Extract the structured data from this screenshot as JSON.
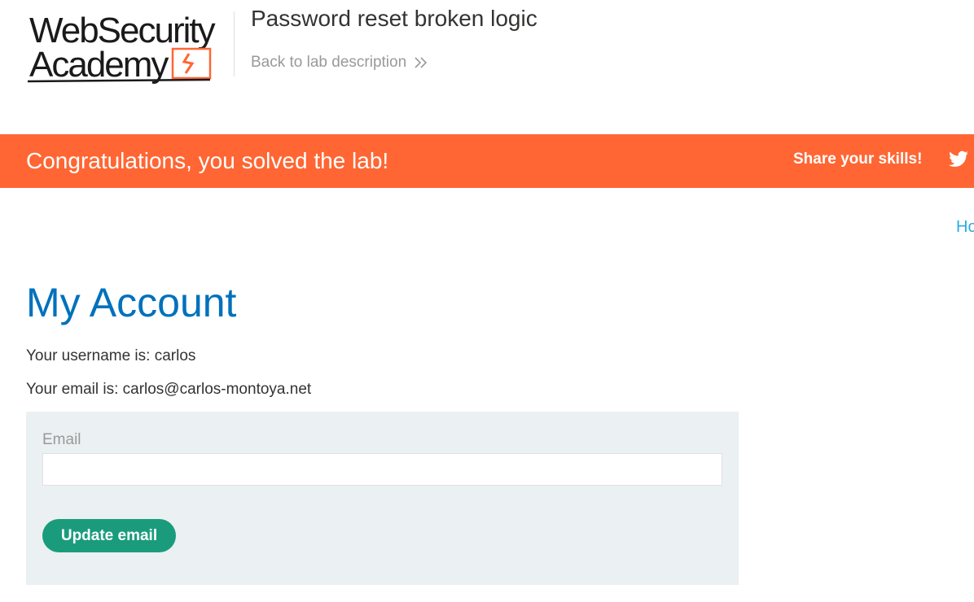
{
  "logo": {
    "line1": "WebSecurity",
    "line2": "Academy",
    "accent": "#ff6633"
  },
  "header": {
    "lab_title": "Password reset broken logic",
    "back_link": "Back to lab description",
    "back_icon": "double-chevron-right-icon"
  },
  "banner": {
    "message": "Congratulations, you solved the lab!",
    "share_label": "Share your skills!",
    "share_icon": "twitter-icon",
    "color": "#ff6633"
  },
  "nav": {
    "home_partial": "Ho"
  },
  "main": {
    "heading": "My Account",
    "username_line": "Your username is: carlos",
    "email_line": "Your email is: carlos@carlos-montoya.net",
    "form": {
      "email_label": "Email",
      "email_value": "",
      "submit_label": "Update email"
    }
  },
  "colors": {
    "heading_blue": "#0071bc",
    "link_blue": "#29abe2",
    "button_green": "#1a9c7c",
    "panel_bg": "#ebf0f2"
  }
}
